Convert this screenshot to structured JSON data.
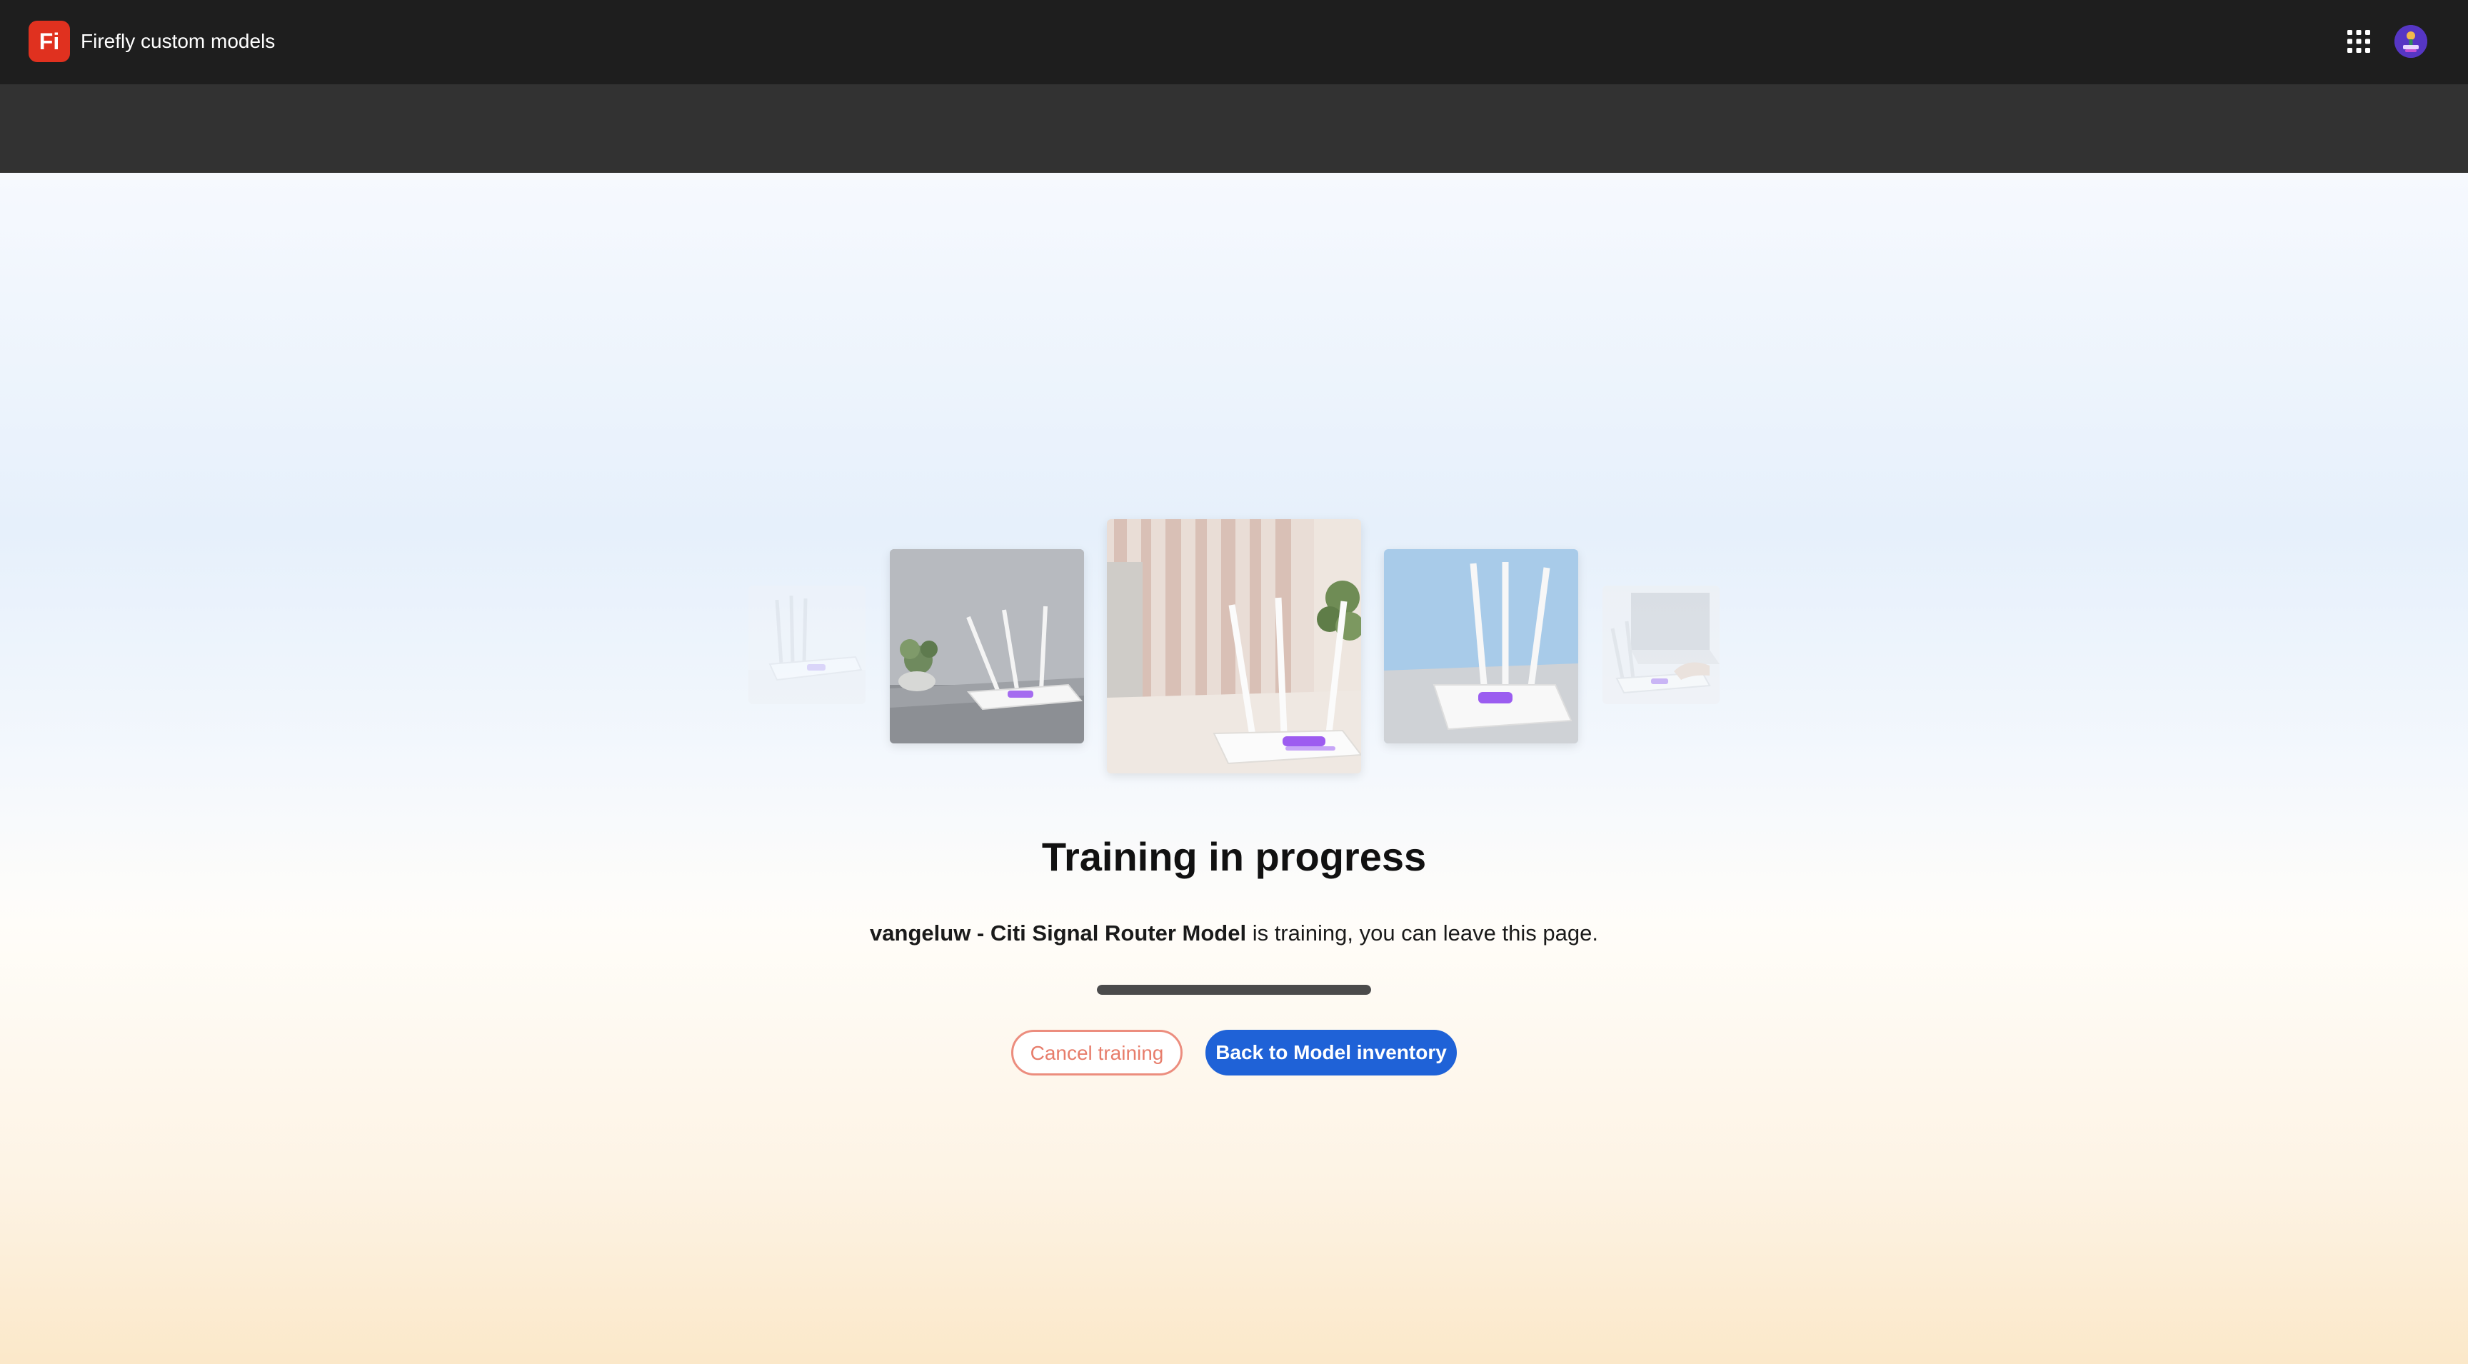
{
  "header": {
    "logo_text": "Fi",
    "app_title": "Firefly custom models",
    "apps_icon": "app-grid-icon",
    "avatar_icon": "user-avatar-icon"
  },
  "main": {
    "headline": "Training in progress",
    "model_name": "vangeluw - Citi Signal Router Model",
    "status_text": " is training, you can leave this page.",
    "progress_percent": 100,
    "cancel_label": "Cancel training",
    "back_label": "Back to Model inventory"
  },
  "colors": {
    "brand": "#e0311f",
    "accent": "#1f62d7",
    "cancel": "#ec8d7e"
  }
}
